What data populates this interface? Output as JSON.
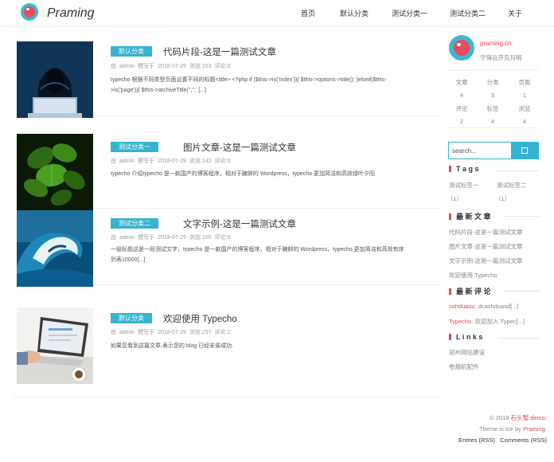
{
  "header": {
    "brand": "Praming",
    "nav": [
      "首页",
      "默认分类",
      "测试分类一",
      "测试分类二",
      "关于"
    ]
  },
  "colors": {
    "accent": "#36b3d0",
    "red": "#e5484d"
  },
  "posts": [
    {
      "category": "默认分类",
      "title": "代码片段-这是一篇测试文章",
      "meta": {
        "by": "由",
        "author": "admin",
        "wrote": "撰写于",
        "date": "2018-07-29",
        "views": "浏览:153",
        "comments": "评论:0"
      },
      "excerpt": "typecho 根据不同类型页面设置不同的标题<title> <?php if ($this->is('index')){ $this->options->title(); }elseif($this->is('page')){ $this->archiveTitle('','',' [...]",
      "thumb": "hacker-image"
    },
    {
      "category": "测试分类一",
      "title": "图片文章-这是一篇测试文章",
      "meta": {
        "by": "由",
        "author": "admin",
        "wrote": "撰写于",
        "date": "2018-07-29",
        "views": "浏览:142",
        "comments": "评论:0"
      },
      "excerpt": "typecho 介绍typecho 是一款国产的博客程序，相对于臃肿的 Wordpress，typecho 更加简洁和高效绿叶夕阳",
      "thumb": "leaves-image"
    },
    {
      "category": "测试分类二",
      "title": "文字示例-这是一篇测试文章",
      "meta": {
        "by": "由",
        "author": "admin",
        "wrote": "撰写于",
        "date": "2018-07-29",
        "views": "浏览:105",
        "comments": "评论:0"
      },
      "excerpt": "一级标题这是一段测试文字，typecho 是一款国产的博客程序，相对于臃肿的 Wordpress，typecho 更加简洁和高效有序列表10000[...]",
      "thumb": "wave-image"
    },
    {
      "category": "默认分类",
      "title": "欢迎使用 Typecho",
      "meta": {
        "by": "由",
        "author": "admin",
        "wrote": "撰写于",
        "date": "2018-07-29",
        "views": "浏览:297",
        "comments": "评论:2"
      },
      "excerpt": "如果您看到这篇文章,表示您的 blog 已经安装成功.",
      "thumb": "laptop-image"
    }
  ],
  "sidebar": {
    "site": "praming.cn",
    "motto": "守得云开见月明",
    "stats": [
      {
        "label": "文章",
        "value": "4"
      },
      {
        "label": "分类",
        "value": "3"
      },
      {
        "label": "页面",
        "value": "1"
      },
      {
        "label": "评论",
        "value": "2"
      },
      {
        "label": "标签",
        "value": "4"
      },
      {
        "label": "浏览",
        "value": "4"
      }
    ],
    "search_placeholder": "search...",
    "tags_title": "T a g s",
    "tags": [
      {
        "name": "测试标签一",
        "count": "（1）"
      },
      {
        "name": "测试标签二",
        "count": "（1）"
      }
    ],
    "recent_title": "最 新 文 章",
    "recent": [
      "代码片段-这是一篇测试文章",
      "图片文章-这是一篇测试文章",
      "文字示例-这是一篇测试文章",
      "欢迎使用 Typecho"
    ],
    "comments_title": "最 新 评 论",
    "comments": [
      {
        "author": "sahduasu",
        "text": ": dcashduasd[...]"
      },
      {
        "author": "Typecho",
        "text": ": 欢迎加入 Typec[...]"
      }
    ],
    "links_title": "L i n k s",
    "links": [
      "郑州网站建设",
      "卷烟机配件"
    ]
  },
  "footer": {
    "copyright_prefix": "© 2018",
    "copyright_name": "石头蟹 demo.",
    "theme_prefix": "Theme is Ice by",
    "theme_name": "Praming.",
    "rss_entries": "Entries (RSS)",
    "rss_comments": "Comments (RSS)"
  }
}
